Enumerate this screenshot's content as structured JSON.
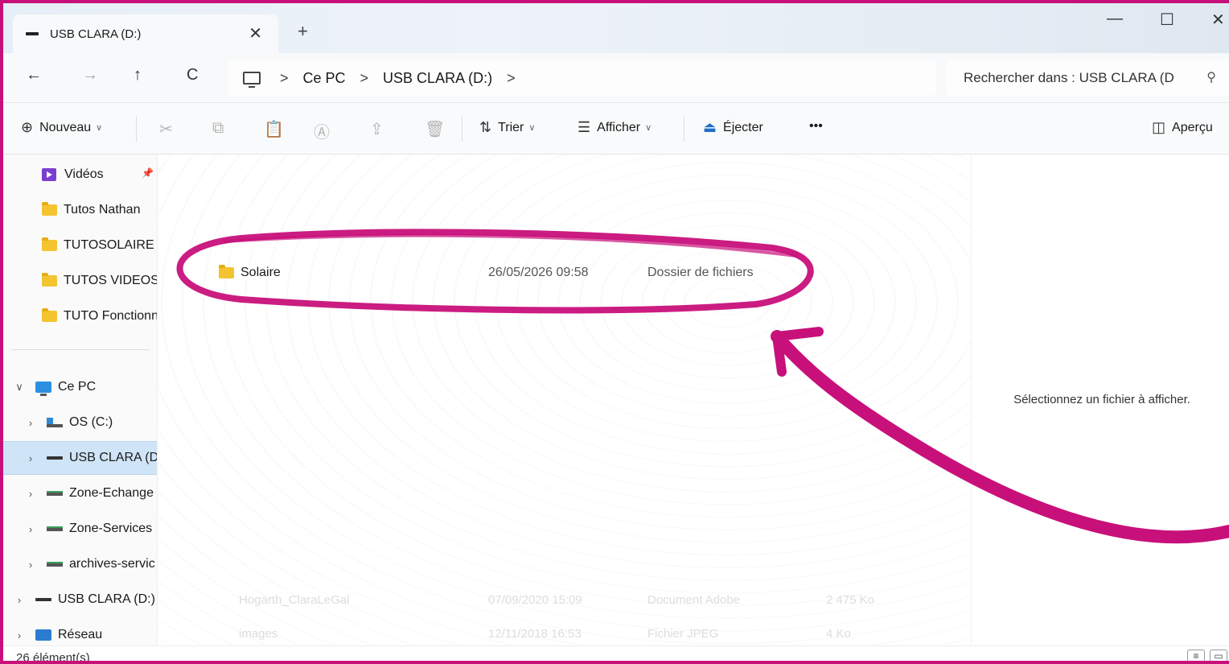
{
  "colors": {
    "accent": "#c8107a",
    "selection": "#cfe4f6",
    "folder": "#f4c430"
  },
  "tab": {
    "title": "USB CLARA (D:)",
    "close": "✕",
    "new": "+"
  },
  "window": {
    "minimize": "—",
    "maximize": "☐",
    "close": "✕"
  },
  "nav": {
    "back": "←",
    "forward": "→",
    "up": "↑",
    "refresh": "C"
  },
  "breadcrumb": {
    "sep": ">",
    "items": [
      "Ce PC",
      "USB CLARA (D:)"
    ]
  },
  "search": {
    "placeholder": "Rechercher dans : USB CLARA (D",
    "icon": "⚲"
  },
  "toolbar": {
    "new_label": "Nouveau",
    "sort_label": "Trier",
    "view_label": "Afficher",
    "eject_label": "Éjecter",
    "more_label": "•••",
    "preview_label": "Aperçu"
  },
  "sidebar": {
    "items": [
      {
        "label": "Vidéos",
        "icon": "video-icon"
      },
      {
        "label": "Tutos Nathan",
        "icon": "folder-icon"
      },
      {
        "label": "TUTOSOLAIRE",
        "icon": "folder-icon"
      },
      {
        "label": "TUTOS VIDEOS",
        "icon": "folder-icon"
      },
      {
        "label": "TUTO Fonctionn",
        "icon": "folder-icon"
      },
      {
        "label": "Ce PC",
        "icon": "computer-icon"
      },
      {
        "label": "OS (C:)",
        "icon": "os-drive-icon"
      },
      {
        "label": "USB CLARA (D",
        "icon": "usb-drive-icon"
      },
      {
        "label": "Zone-Echange",
        "icon": "network-drive-icon"
      },
      {
        "label": "Zone-Services",
        "icon": "network-drive-icon"
      },
      {
        "label": "archives-servic",
        "icon": "network-drive-icon"
      },
      {
        "label": "USB CLARA (D:)",
        "icon": "usb-drive-icon"
      },
      {
        "label": "Réseau",
        "icon": "network-icon"
      }
    ]
  },
  "files": [
    {
      "name": "Solaire",
      "modified": "26/05/2026 09:58",
      "type": "Dossier de fichiers"
    }
  ],
  "faded_rows": [
    {
      "name": "Hogarth_ClaraLeGal",
      "modified": "07/09/2020 15:09",
      "type": "Document Adobe",
      "size": "2 475 Ko"
    },
    {
      "name": "images",
      "modified": "12/11/2018 16:53",
      "type": "Fichier JPEG",
      "size": "4 Ko"
    }
  ],
  "preview": {
    "message": "Sélectionnez un fichier à afficher."
  },
  "status": {
    "count": "26 élément(s)"
  }
}
